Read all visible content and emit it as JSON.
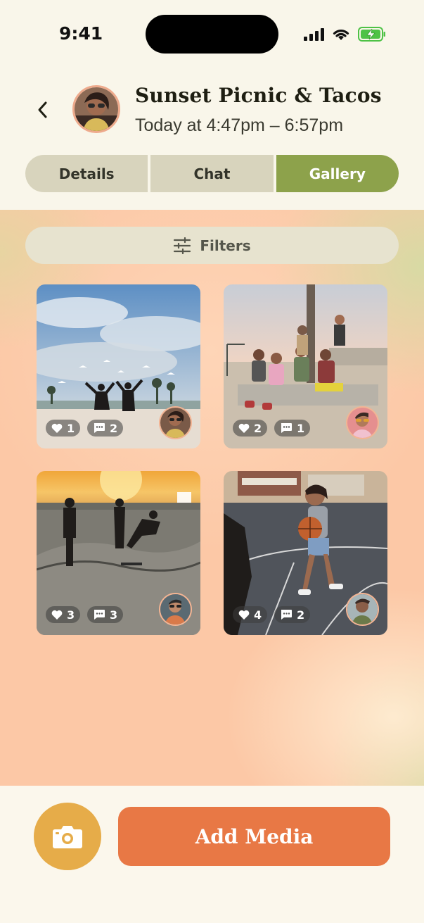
{
  "status_bar": {
    "time": "9:41"
  },
  "header": {
    "title": "Sunset Picnic & Tacos",
    "time_range": "Today at 4:47pm – 6:57pm"
  },
  "tabs": [
    {
      "label": "Details",
      "active": false
    },
    {
      "label": "Chat",
      "active": false
    },
    {
      "label": "Gallery",
      "active": true
    }
  ],
  "filters": {
    "label": "Filters"
  },
  "gallery": [
    {
      "likes": "1",
      "comments": "2"
    },
    {
      "likes": "2",
      "comments": "1"
    },
    {
      "likes": "3",
      "comments": "3"
    },
    {
      "likes": "4",
      "comments": "2"
    }
  ],
  "actions": {
    "add_media_label": "Add Media"
  },
  "colors": {
    "accent_green": "#8da24b",
    "accent_orange": "#e87845",
    "accent_yellow": "#e6ac49"
  }
}
